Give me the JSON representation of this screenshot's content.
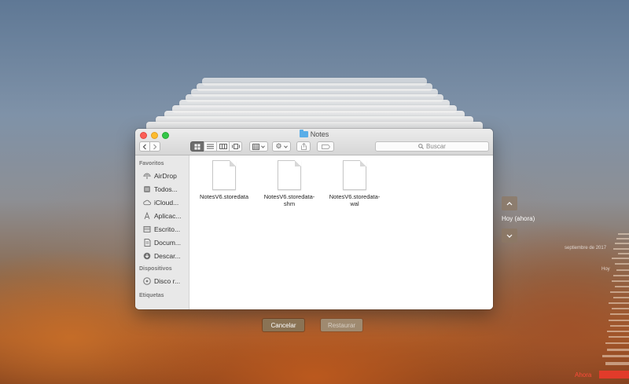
{
  "window": {
    "title": "Notes",
    "search_placeholder": "Buscar"
  },
  "sidebar": {
    "sections": [
      {
        "header": "Favoritos",
        "items": [
          {
            "label": "AirDrop",
            "icon": "airdrop-icon"
          },
          {
            "label": "Todos...",
            "icon": "all-files-icon"
          },
          {
            "label": "iCloud...",
            "icon": "cloud-icon"
          },
          {
            "label": "Aplicac...",
            "icon": "applications-icon"
          },
          {
            "label": "Escrito...",
            "icon": "desktop-icon"
          },
          {
            "label": "Docum...",
            "icon": "document-icon"
          },
          {
            "label": "Descar...",
            "icon": "download-icon"
          }
        ]
      },
      {
        "header": "Dispositivos",
        "items": [
          {
            "label": "Disco r...",
            "icon": "disk-icon"
          }
        ]
      },
      {
        "header": "Etiquetas",
        "items": []
      }
    ]
  },
  "files": [
    {
      "name": "NotesV6.storedata"
    },
    {
      "name": "NotesV6.storedata-shm"
    },
    {
      "name": "NotesV6.storedata-wal"
    }
  ],
  "buttons": {
    "cancel": "Cancelar",
    "restore": "Restaurar"
  },
  "time_machine": {
    "current_label": "Hoy (ahora)",
    "timeline_labels": [
      "septiembre de 2017",
      "Hoy"
    ],
    "now_label": "Ahora",
    "accent_color": "#e23b2a"
  }
}
